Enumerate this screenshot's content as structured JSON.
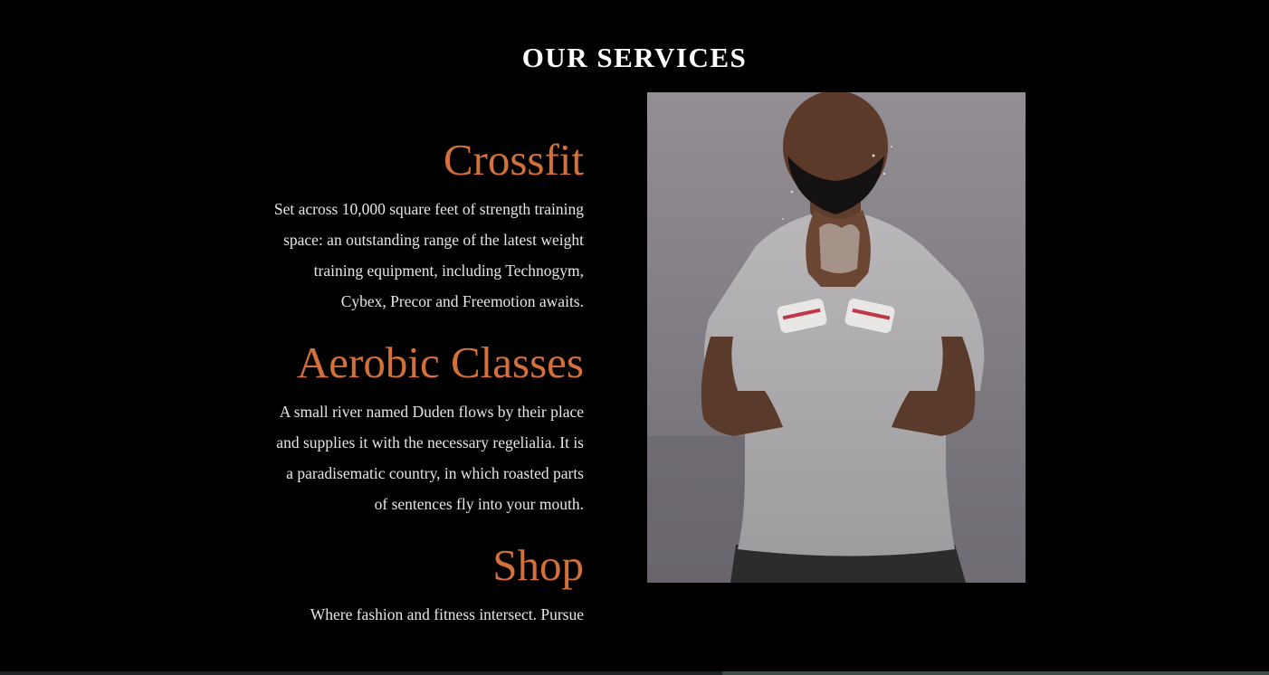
{
  "section": {
    "title": "OUR SERVICES"
  },
  "services": [
    {
      "name": "Crossfit",
      "description": "Set across 10,000 square feet of strength training space: an outstanding range of the latest weight training equipment, including Technogym, Cybex, Precor and Freemotion awaits."
    },
    {
      "name": "Aerobic Classes",
      "description": "A small river named Duden flows by their place and supplies it with the necessary regelialia. It is a paradisematic country, in which roasted parts of sentences fly into your mouth."
    },
    {
      "name": "Shop",
      "description": "Where fashion and fitness intersect. Pursue"
    }
  ],
  "colors": {
    "background": "#000000",
    "accent": "#d4703a",
    "heading": "#ffffff",
    "body_text": "#e6e6e6"
  }
}
